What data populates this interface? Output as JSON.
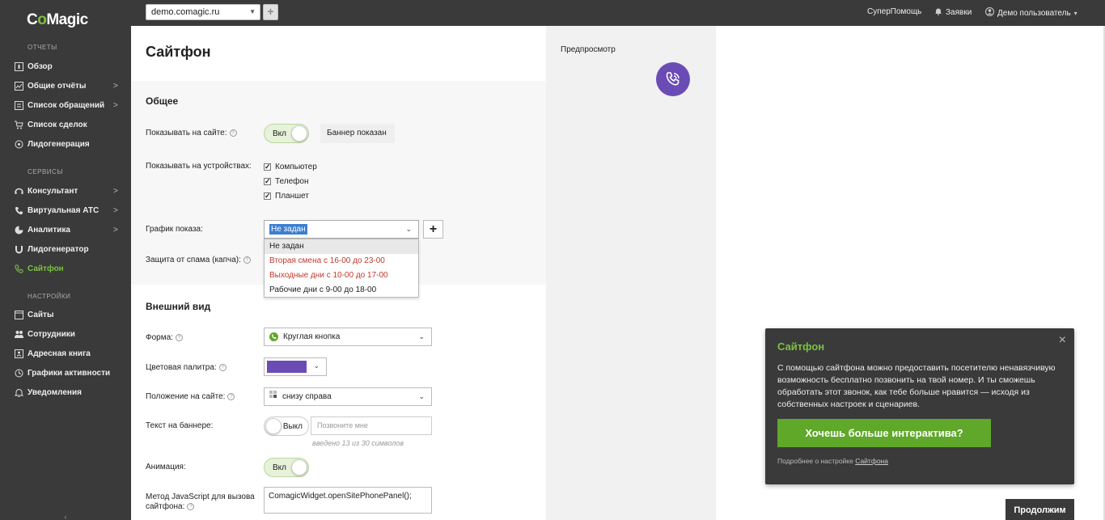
{
  "app": {
    "logo_prefix": "C",
    "logo_o": "o",
    "logo_suffix": "Magic"
  },
  "sidebar": {
    "sections": {
      "reports": "ОТЧЕТЫ",
      "services": "СЕРВИСЫ",
      "settings": "НАСТРОЙКИ"
    },
    "items": [
      {
        "label": "Обзор",
        "icon": "overview-icon",
        "chevron": ""
      },
      {
        "label": "Общие отчёты",
        "icon": "reports-icon",
        "chevron": ">"
      },
      {
        "label": "Список обращений",
        "icon": "list-icon",
        "chevron": ">"
      },
      {
        "label": "Список сделок",
        "icon": "cart-icon",
        "chevron": ""
      },
      {
        "label": "Лидогенерация",
        "icon": "leadgen-icon",
        "chevron": ""
      },
      {
        "label": "Консультант",
        "icon": "consultant-icon",
        "chevron": ">"
      },
      {
        "label": "Виртуальная АТС",
        "icon": "phone-icon",
        "chevron": ">"
      },
      {
        "label": "Аналитика",
        "icon": "analytics-icon",
        "chevron": ">"
      },
      {
        "label": "Лидогенератор",
        "icon": "magnet-icon",
        "chevron": ""
      },
      {
        "label": "Сайтфон",
        "icon": "sitephone-icon",
        "chevron": ""
      },
      {
        "label": "Сайты",
        "icon": "sites-icon",
        "chevron": ""
      },
      {
        "label": "Сотрудники",
        "icon": "employees-icon",
        "chevron": ""
      },
      {
        "label": "Адресная книга",
        "icon": "addressbook-icon",
        "chevron": ""
      },
      {
        "label": "Графики активности",
        "icon": "activity-icon",
        "chevron": ""
      },
      {
        "label": "Уведомления",
        "icon": "bell-icon",
        "chevron": ""
      }
    ],
    "collapse": "‹"
  },
  "topbar": {
    "site": "demo.comagic.ru",
    "add": "+",
    "help": "СуперПомощь",
    "requests": "Заявки",
    "user": "Демо пользователь"
  },
  "page": {
    "title": "Сайтфон"
  },
  "general": {
    "title": "Общее",
    "show_on_site_label": "Показывать на сайте:",
    "show_on_site_toggle": "Вкл",
    "banner_status": "Баннер показан",
    "devices_label": "Показывать на устройствах:",
    "devices": [
      "Компьютер",
      "Телефон",
      "Планшет"
    ],
    "schedule_label": "График показа:",
    "schedule_value": "Не задан",
    "schedule_options": [
      "Не задан",
      "Вторая смена с 16-00 до 23-00",
      "Выходные дни с 10-00 до 17-00",
      "Рабочие дни с 9-00 до 18-00"
    ],
    "spam_label": "Защита от спама (капча):",
    "help_glyph": "?"
  },
  "appearance": {
    "title": "Внешний вид",
    "form_label": "Форма:",
    "form_value": "Круглая кнопка",
    "palette_label": "Цветовая палитра:",
    "palette_color": "#6b4cb5",
    "position_label": "Положение на сайте:",
    "position_value": "снизу справа",
    "banner_text_label": "Текст на баннере:",
    "banner_toggle": "Выкл",
    "banner_placeholder": "Позвоните мне",
    "banner_counter": "введено 13 из 30 символов",
    "animation_label": "Анимация:",
    "animation_toggle": "Вкл",
    "js_label_1": "Метод JavaScript для вызова",
    "js_label_2": "сайтфона:",
    "js_value": "ComagicWidget.openSitePhonePanel();"
  },
  "preview": {
    "title": "Предпросмотр"
  },
  "info": {
    "title": "Сайтфон",
    "close": "×",
    "body": "С помощью сайтфона можно предоставить посетителю ненавязчивую возможность бесплатно позвонить на твой номер. И ты сможешь обработать этот звонок, как тебе больше нравится — исходя из собственных настроек и сценариев.",
    "cta": "Хочешь больше интерактива?",
    "more_prefix": "Подробнее о настройке",
    "more_link": "Сайтфона"
  },
  "footer": {
    "continue": "Продолжим"
  },
  "colors": {
    "accent": "#7cc241",
    "sidebar": "#3a3a3a",
    "widget": "#6b4cb5"
  }
}
